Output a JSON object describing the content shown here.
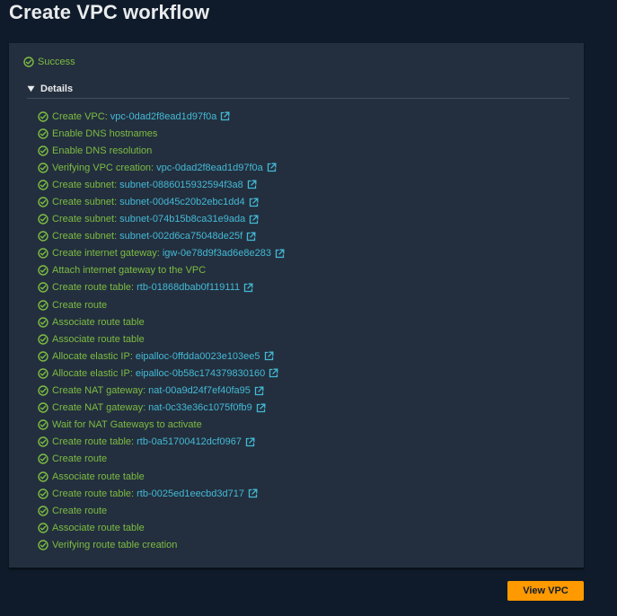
{
  "page": {
    "title": "Create VPC workflow"
  },
  "colors": {
    "background": "#0f1b2a",
    "panel": "#232f3e",
    "success_green": "#7dbc42",
    "link_blue": "#44b9d6",
    "primary_button": "#ff9900"
  },
  "status": {
    "icon": "success-check-icon",
    "label": "Success"
  },
  "details": {
    "label": "Details",
    "expanded": true,
    "steps": [
      {
        "text": "Create VPC:",
        "link": "vpc-0dad2f8ead1d97f0a"
      },
      {
        "text": "Enable DNS hostnames"
      },
      {
        "text": "Enable DNS resolution"
      },
      {
        "text": "Verifying VPC creation:",
        "link": "vpc-0dad2f8ead1d97f0a"
      },
      {
        "text": "Create subnet:",
        "link": "subnet-0886015932594f3a8"
      },
      {
        "text": "Create subnet:",
        "link": "subnet-00d45c20b2ebc1dd4"
      },
      {
        "text": "Create subnet:",
        "link": "subnet-074b15b8ca31e9ada"
      },
      {
        "text": "Create subnet:",
        "link": "subnet-002d6ca75048de25f"
      },
      {
        "text": "Create internet gateway:",
        "link": "igw-0e78d9f3ad6e8e283"
      },
      {
        "text": "Attach internet gateway to the VPC"
      },
      {
        "text": "Create route table:",
        "link": "rtb-01868dbab0f119111"
      },
      {
        "text": "Create route"
      },
      {
        "text": "Associate route table"
      },
      {
        "text": "Associate route table"
      },
      {
        "text": "Allocate elastic IP:",
        "link": "eipalloc-0ffdda0023e103ee5"
      },
      {
        "text": "Allocate elastic IP:",
        "link": "eipalloc-0b58c174379830160"
      },
      {
        "text": "Create NAT gateway:",
        "link": "nat-00a9d24f7ef40fa95"
      },
      {
        "text": "Create NAT gateway:",
        "link": "nat-0c33e36c1075f0fb9"
      },
      {
        "text": "Wait for NAT Gateways to activate"
      },
      {
        "text": "Create route table:",
        "link": "rtb-0a51700412dcf0967"
      },
      {
        "text": "Create route"
      },
      {
        "text": "Associate route table"
      },
      {
        "text": "Create route table:",
        "link": "rtb-0025ed1eecbd3d717"
      },
      {
        "text": "Create route"
      },
      {
        "text": "Associate route table"
      },
      {
        "text": "Verifying route table creation"
      }
    ]
  },
  "actions": {
    "view_vpc_label": "View VPC"
  }
}
